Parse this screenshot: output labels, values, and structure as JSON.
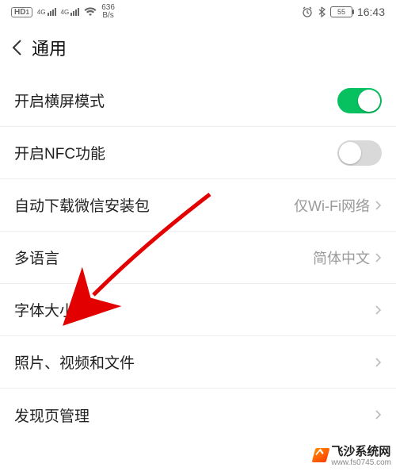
{
  "status": {
    "hd_label": "HD",
    "signal_4g_a": "4G",
    "signal_4g_b": "4G",
    "speed_value": "636",
    "speed_unit": "B/s",
    "battery_text": "55",
    "time": "16:43"
  },
  "nav": {
    "title": "通用"
  },
  "rows": {
    "landscape": {
      "label": "开启横屏模式",
      "on": true
    },
    "nfc": {
      "label": "开启NFC功能",
      "on": false
    },
    "auto_download": {
      "label": "自动下载微信安装包",
      "value": "仅Wi-Fi网络"
    },
    "language": {
      "label": "多语言",
      "value": "简体中文"
    },
    "font_size": {
      "label": "字体大小"
    },
    "media": {
      "label": "照片、视频和文件"
    },
    "discover": {
      "label": "发现页管理"
    }
  },
  "watermark": {
    "title": "飞沙系统网",
    "url": "www.fs0745.com"
  }
}
